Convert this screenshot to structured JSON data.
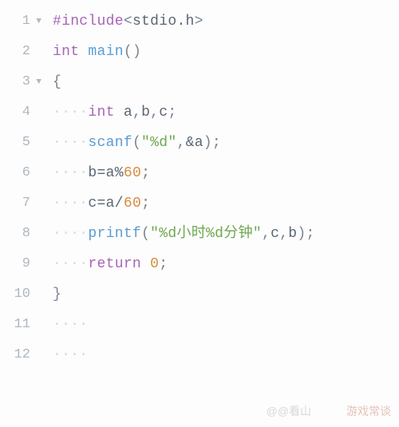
{
  "lines": [
    {
      "num": "1",
      "fold": true,
      "tokens": [
        {
          "cls": "preprocessor",
          "t": "#include"
        },
        {
          "cls": "punct",
          "t": "<"
        },
        {
          "cls": "ident",
          "t": "stdio.h"
        },
        {
          "cls": "punct",
          "t": ">"
        }
      ]
    },
    {
      "num": "2",
      "fold": false,
      "tokens": [
        {
          "cls": "type",
          "t": "int"
        },
        {
          "cls": "",
          "t": " "
        },
        {
          "cls": "func",
          "t": "main"
        },
        {
          "cls": "punct",
          "t": "()"
        }
      ]
    },
    {
      "num": "3",
      "fold": true,
      "tokens": [
        {
          "cls": "punct",
          "t": "{"
        }
      ]
    },
    {
      "num": "4",
      "fold": false,
      "indent": 4,
      "tokens": [
        {
          "cls": "type",
          "t": "int"
        },
        {
          "cls": "",
          "t": " "
        },
        {
          "cls": "ident",
          "t": "a"
        },
        {
          "cls": "punct",
          "t": ","
        },
        {
          "cls": "ident",
          "t": "b"
        },
        {
          "cls": "punct",
          "t": ","
        },
        {
          "cls": "ident",
          "t": "c"
        },
        {
          "cls": "punct",
          "t": ";"
        }
      ]
    },
    {
      "num": "5",
      "fold": false,
      "indent": 4,
      "tokens": [
        {
          "cls": "func",
          "t": "scanf"
        },
        {
          "cls": "punct",
          "t": "("
        },
        {
          "cls": "string",
          "t": "\"%d\""
        },
        {
          "cls": "punct",
          "t": ","
        },
        {
          "cls": "op",
          "t": "&"
        },
        {
          "cls": "ident",
          "t": "a"
        },
        {
          "cls": "punct",
          "t": ");"
        }
      ]
    },
    {
      "num": "6",
      "fold": false,
      "indent": 4,
      "tokens": [
        {
          "cls": "ident",
          "t": "b"
        },
        {
          "cls": "op",
          "t": "="
        },
        {
          "cls": "ident",
          "t": "a"
        },
        {
          "cls": "op",
          "t": "%"
        },
        {
          "cls": "number",
          "t": "60"
        },
        {
          "cls": "punct",
          "t": ";"
        }
      ]
    },
    {
      "num": "7",
      "fold": false,
      "indent": 4,
      "tokens": [
        {
          "cls": "ident",
          "t": "c"
        },
        {
          "cls": "op",
          "t": "="
        },
        {
          "cls": "ident",
          "t": "a"
        },
        {
          "cls": "op",
          "t": "/"
        },
        {
          "cls": "number",
          "t": "60"
        },
        {
          "cls": "punct",
          "t": ";"
        }
      ]
    },
    {
      "num": "8",
      "fold": false,
      "indent": 4,
      "tokens": [
        {
          "cls": "func",
          "t": "printf"
        },
        {
          "cls": "punct",
          "t": "("
        },
        {
          "cls": "string",
          "t": "\"%d小时%d分钟\""
        },
        {
          "cls": "punct",
          "t": ","
        },
        {
          "cls": "ident",
          "t": "c"
        },
        {
          "cls": "punct",
          "t": ","
        },
        {
          "cls": "ident",
          "t": "b"
        },
        {
          "cls": "punct",
          "t": ");"
        }
      ]
    },
    {
      "num": "9",
      "fold": false,
      "indent": 4,
      "tokens": [
        {
          "cls": "keyword",
          "t": "return"
        },
        {
          "cls": "",
          "t": " "
        },
        {
          "cls": "number",
          "t": "0"
        },
        {
          "cls": "punct",
          "t": ";"
        }
      ]
    },
    {
      "num": "10",
      "fold": false,
      "tokens": [
        {
          "cls": "punct",
          "t": "}"
        }
      ]
    },
    {
      "num": "11",
      "fold": false,
      "indent": 4,
      "tokens": []
    },
    {
      "num": "12",
      "fold": false,
      "indent": 4,
      "tokens": []
    }
  ],
  "watermark": "游戏常谈",
  "watermark2": "@@看山"
}
